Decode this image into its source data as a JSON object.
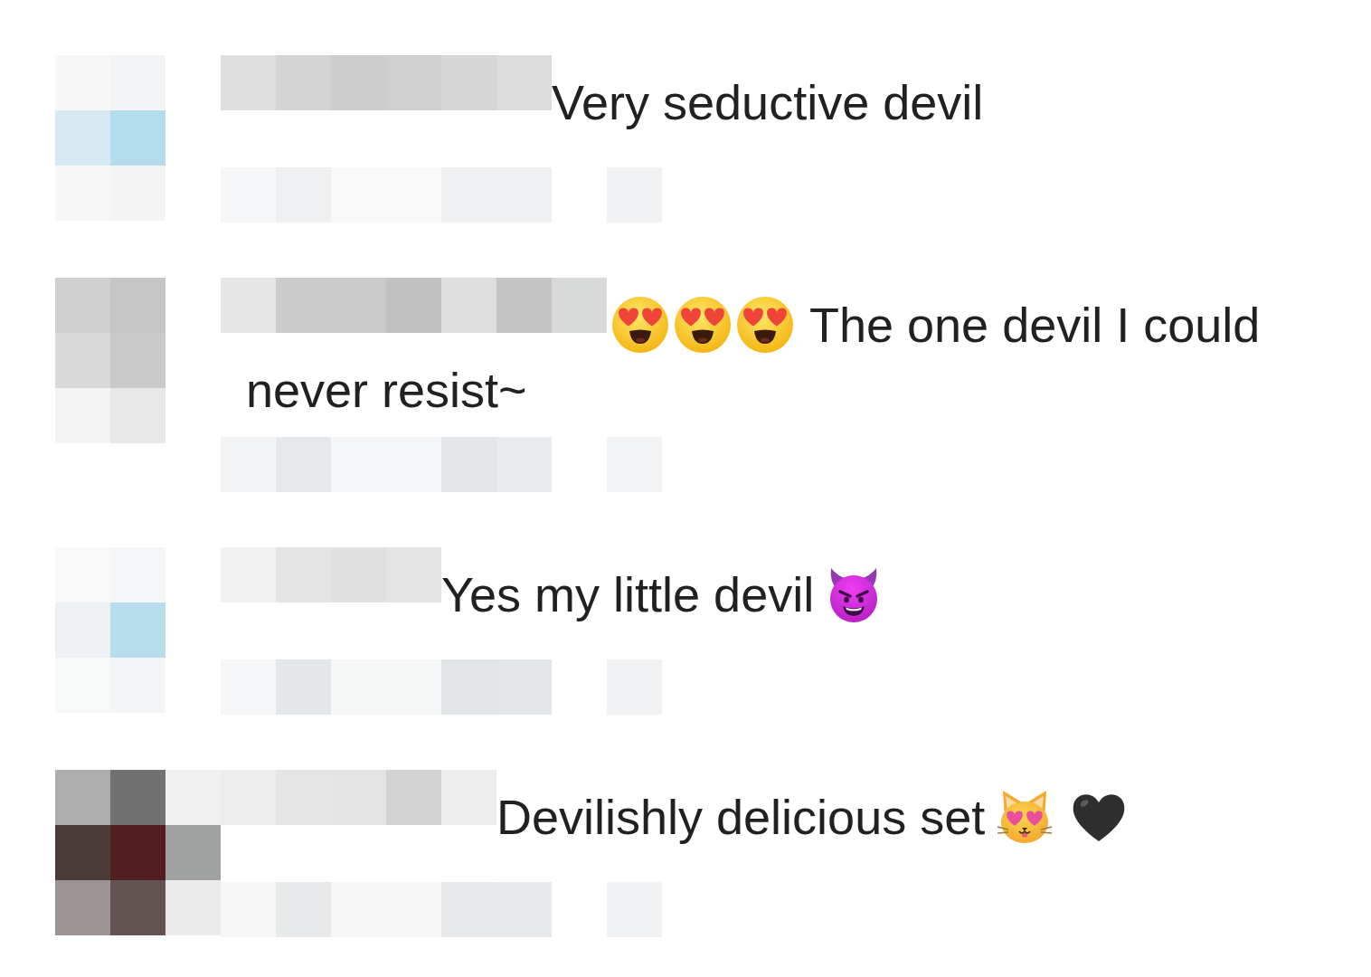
{
  "comments": [
    {
      "lines": [
        [
          {
            "kind": "text",
            "text": "Very seductive devil"
          }
        ]
      ]
    },
    {
      "lines": [
        [
          {
            "kind": "hearteyes"
          },
          {
            "kind": "hearteyes"
          },
          {
            "kind": "hearteyes"
          },
          {
            "kind": "text",
            "text": "The one devil I could"
          }
        ],
        [
          {
            "kind": "text",
            "text": "never resist~"
          }
        ]
      ]
    },
    {
      "lines": [
        [
          {
            "kind": "text",
            "text": "Yes my little devil"
          },
          {
            "kind": "devil"
          }
        ]
      ]
    },
    {
      "lines": [
        [
          {
            "kind": "text",
            "text": "Devilishly delicious set"
          },
          {
            "kind": "cathearteyes"
          },
          {
            "kind": "heart"
          }
        ]
      ]
    }
  ]
}
